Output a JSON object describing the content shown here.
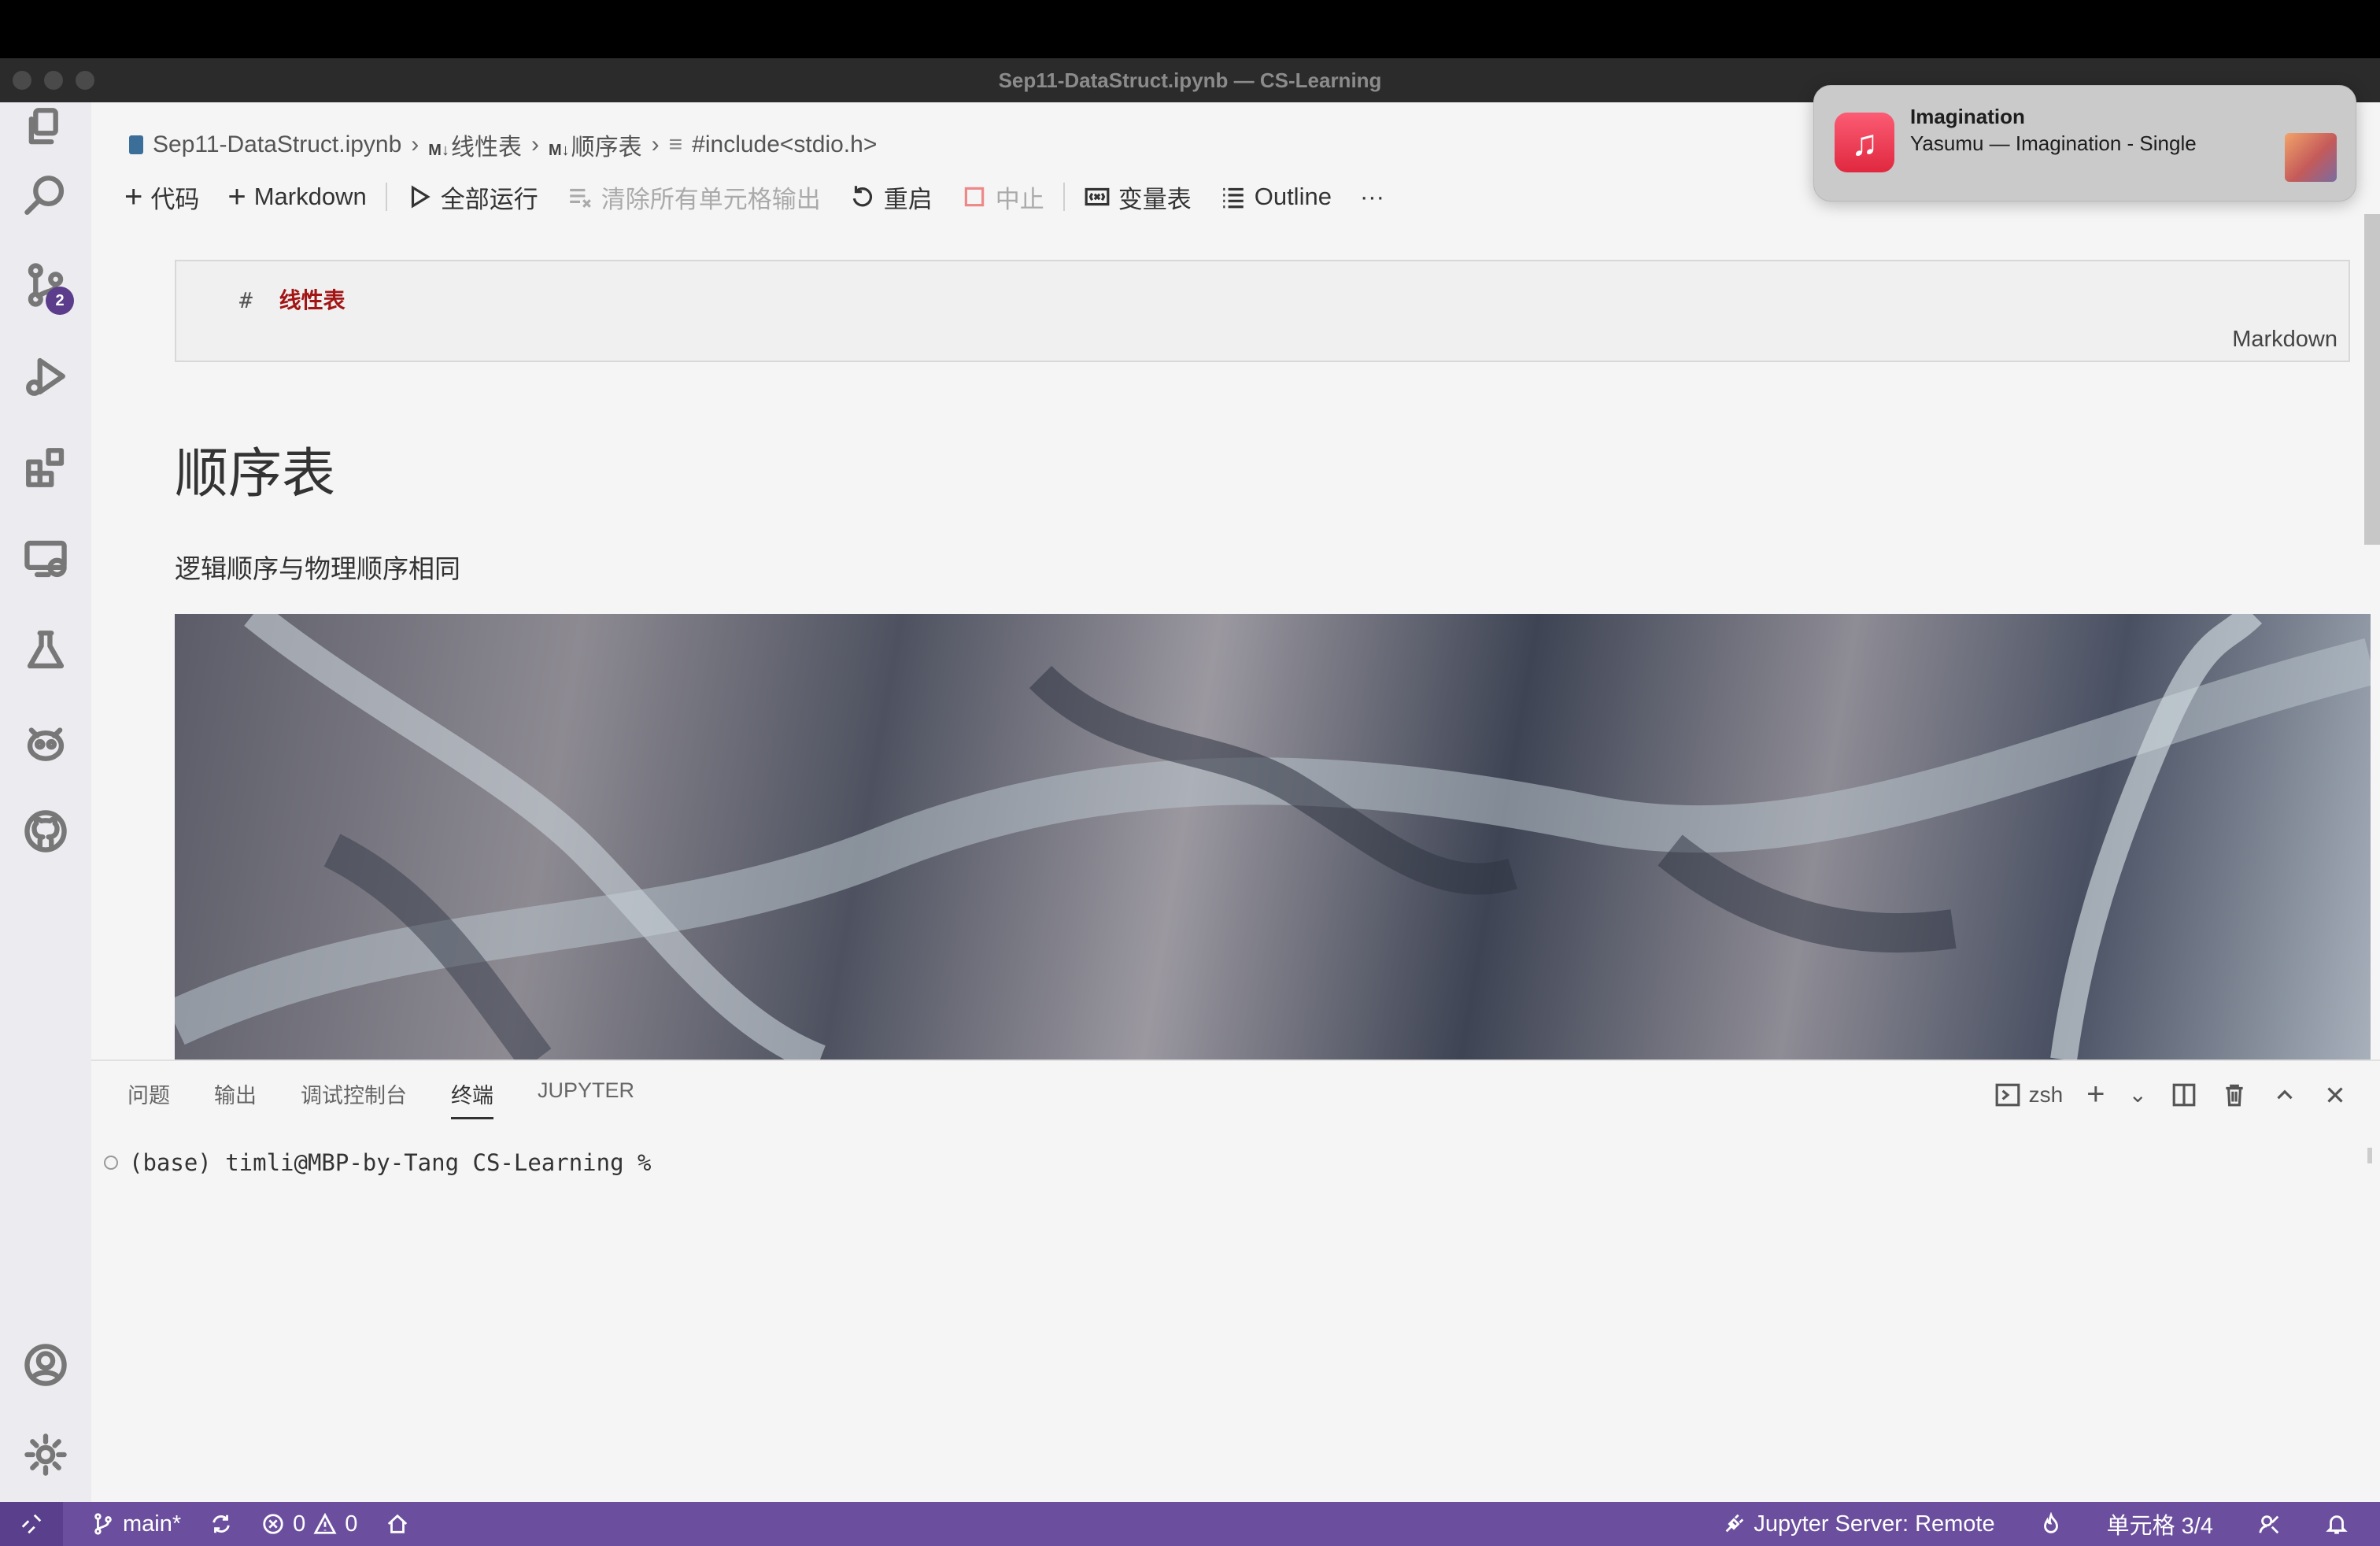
{
  "window": {
    "title": "Sep11-DataStruct.ipynb — CS-Learning"
  },
  "activity_bar": {
    "scm_badge": "2"
  },
  "breadcrumb": {
    "file": "Sep11-DataStruct.ipynb",
    "crumb1": "线性表",
    "crumb2": "顺序表",
    "crumb3": "#include<stdio.h>",
    "md_mark": "M↓"
  },
  "toolbar": {
    "code": "代码",
    "markdown": "Markdown",
    "run_all": "全部运行",
    "clear_outputs": "清除所有单元格输出",
    "restart": "重启",
    "interrupt": "中止",
    "variables": "变量表",
    "outline": "Outline",
    "more": "···"
  },
  "markdown_cell": {
    "hash": "#",
    "heading": "线性表",
    "language": "Markdown"
  },
  "rendered": {
    "heading": "顺序表",
    "paragraph": "逻辑顺序与物理顺序相同"
  },
  "panel": {
    "tabs": [
      "问题",
      "输出",
      "调试控制台",
      "终端",
      "JUPYTER"
    ],
    "active_tab": "终端",
    "shell": "zsh",
    "prompt": "(base) timli@MBP-by-Tang CS-Learning %"
  },
  "status_bar": {
    "branch": "main*",
    "errors": "0",
    "warnings": "0",
    "jupyter_server": "Jupyter Server: Remote",
    "cell_position": "单元格 3/4"
  },
  "notification": {
    "title": "Imagination",
    "body": "Yasumu — Imagination - Single"
  }
}
